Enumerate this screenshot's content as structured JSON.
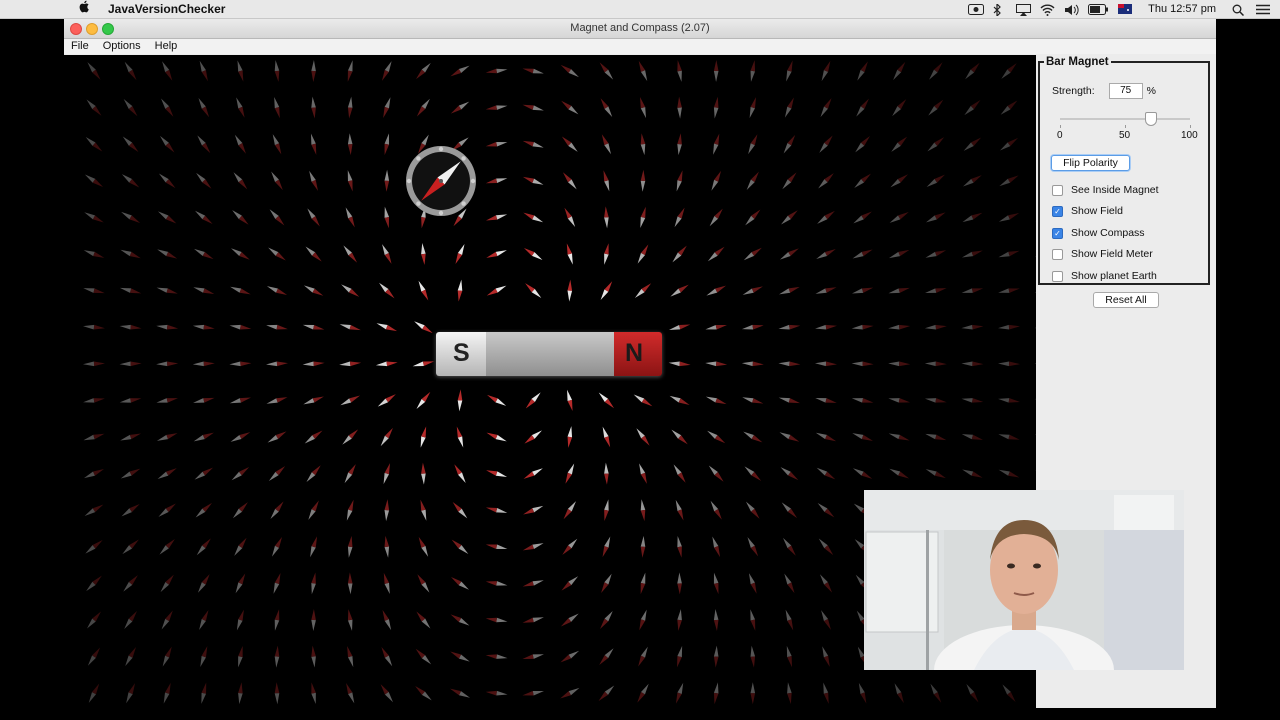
{
  "system_menubar": {
    "app_name": "JavaVersionChecker",
    "clock": "Thu 12:57 pm"
  },
  "window": {
    "title": "Magnet and Compass (2.07)",
    "menu": [
      "File",
      "Options",
      "Help"
    ]
  },
  "magnet": {
    "south_label": "S",
    "north_label": "N"
  },
  "panel": {
    "title": "Bar Magnet",
    "strength_label": "Strength:",
    "strength_value": "75",
    "strength_unit": "%",
    "slider_value_percent": 75,
    "slider_ticks": [
      "0",
      "50",
      "100"
    ],
    "flip_button": "Flip Polarity",
    "checkboxes": [
      {
        "label": "See Inside Magnet",
        "checked": false
      },
      {
        "label": "Show Field",
        "checked": true
      },
      {
        "label": "Show Compass",
        "checked": true
      },
      {
        "label": "Show Field Meter",
        "checked": false
      },
      {
        "label": "Show planet Earth",
        "checked": false
      }
    ]
  },
  "reset_button": "Reset All",
  "colors": {
    "field_red": "#b52a2a",
    "field_white": "#e6e6e6",
    "checkbox_blue": "#3a84e6",
    "magnet_north": "#b31b1b",
    "magnet_south": "#d8d8d8"
  },
  "icons": [
    "apple-icon",
    "screen-record-icon",
    "bluetooth-icon",
    "airplay-icon",
    "wifi-icon",
    "volume-icon",
    "battery-icon",
    "flag-icon",
    "search-icon",
    "list-icon",
    "compass-icon",
    "field-arrow-icon"
  ]
}
